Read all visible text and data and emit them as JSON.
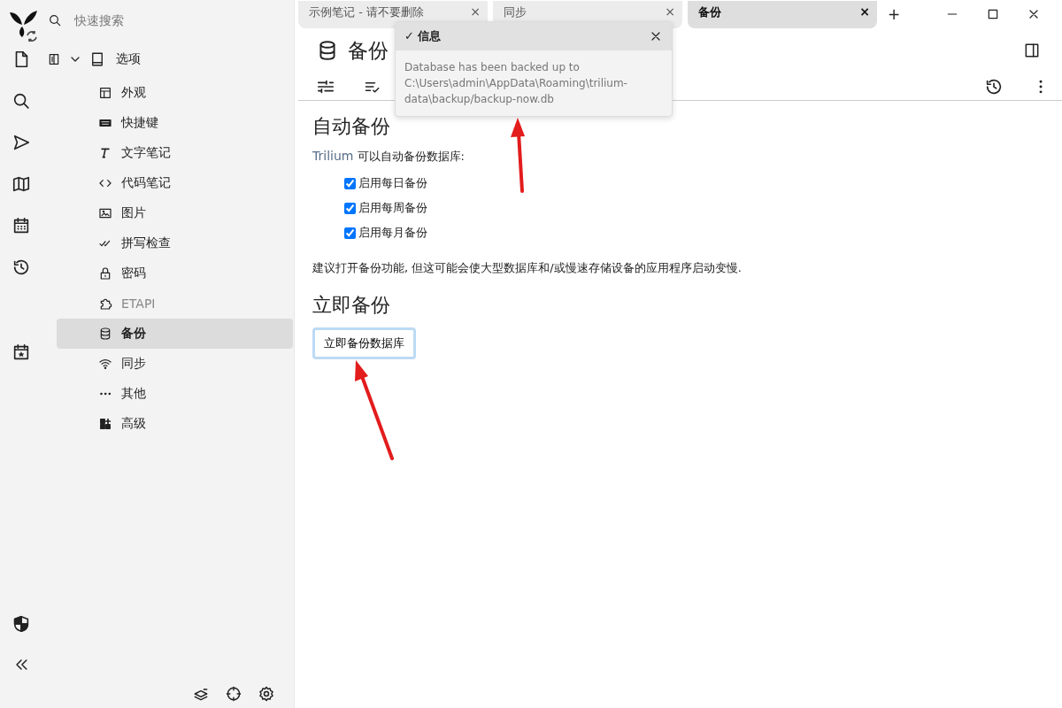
{
  "search": {
    "placeholder": "快速搜索"
  },
  "tree": {
    "label": "选项",
    "expanded": true,
    "children": [
      {
        "label": "外观",
        "selected": false,
        "disabled": false
      },
      {
        "label": "快捷键",
        "selected": false,
        "disabled": false
      },
      {
        "label": "文字笔记",
        "selected": false,
        "disabled": false
      },
      {
        "label": "代码笔记",
        "selected": false,
        "disabled": false
      },
      {
        "label": "图片",
        "selected": false,
        "disabled": false
      },
      {
        "label": "拼写检查",
        "selected": false,
        "disabled": false
      },
      {
        "label": "密码",
        "selected": false,
        "disabled": false
      },
      {
        "label": "ETAPI",
        "selected": false,
        "disabled": true
      },
      {
        "label": "备份",
        "selected": true,
        "disabled": false
      },
      {
        "label": "同步",
        "selected": false,
        "disabled": false
      },
      {
        "label": "其他",
        "selected": false,
        "disabled": false
      },
      {
        "label": "高级",
        "selected": false,
        "disabled": false
      }
    ]
  },
  "tabs": [
    {
      "label": "示例笔记 - 请不要删除",
      "selected": false,
      "close": "×"
    },
    {
      "label": "同步",
      "selected": false,
      "close": "×"
    },
    {
      "label": "备份",
      "selected": true,
      "close": "×"
    }
  ],
  "new_tab": "+",
  "note": {
    "title": "备份"
  },
  "sections": [
    {
      "heading": "自动备份",
      "intro": {
        "link": "Trilium",
        "text": " 可以自动备份数据库:"
      },
      "options": [
        {
          "label": "启用每日备份",
          "checked": true
        },
        {
          "label": "启用每周备份",
          "checked": true
        },
        {
          "label": "启用每月备份",
          "checked": true
        }
      ],
      "note": "建议打开备份功能, 但这可能会使大型数据库和/或慢速存储设备的应用程序启动变慢."
    },
    {
      "heading": "立即备份",
      "button": "立即备份数据库"
    }
  ],
  "toast": {
    "check": "✓",
    "title": "信息",
    "message": "Database has been backed up to C:\\Users\\admin\\AppData\\Roaming\\trilium-data\\backup/backup-now.db"
  }
}
